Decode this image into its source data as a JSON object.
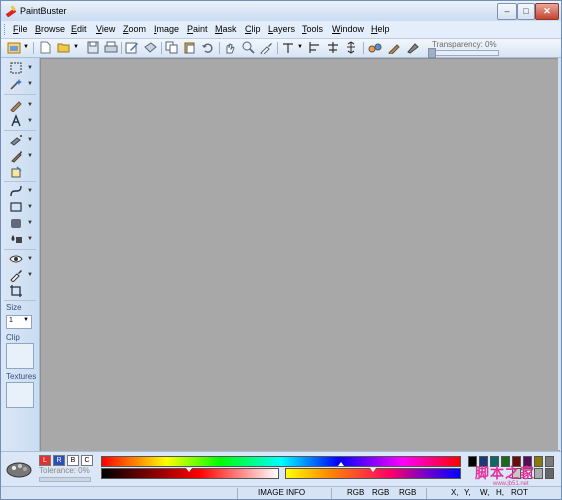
{
  "window": {
    "title": "PaintBuster",
    "controls": {
      "minimize": "–",
      "maximize": "□",
      "close": "✕"
    }
  },
  "menu": [
    {
      "label": "File",
      "key": "F",
      "rest": "ile"
    },
    {
      "label": "Browse",
      "key": "B",
      "rest": "rowse"
    },
    {
      "label": "Edit",
      "key": "E",
      "rest": "dit"
    },
    {
      "label": "View",
      "key": "V",
      "rest": "iew"
    },
    {
      "label": "Zoom",
      "key": "Z",
      "rest": "oom"
    },
    {
      "label": "Image",
      "key": "I",
      "rest": "mage"
    },
    {
      "label": "Paint",
      "key": "P",
      "rest": "aint"
    },
    {
      "label": "Mask",
      "key": "M",
      "rest": "ask"
    },
    {
      "label": "Clip",
      "key": "C",
      "rest": "lip"
    },
    {
      "label": "Layers",
      "key": "L",
      "rest": "ayers"
    },
    {
      "label": "Tools",
      "key": "T",
      "rest": "ools"
    },
    {
      "label": "Window",
      "key": "W",
      "rest": "indow"
    },
    {
      "label": "Help",
      "key": "H",
      "rest": "elp"
    }
  ],
  "toolbar": {
    "transparency_label": "Transparency: 0%",
    "transparency_value": 0
  },
  "left_panel": {
    "size_label": "Size",
    "size_value": "1",
    "clip_label": "Clip",
    "textures_label": "Textures"
  },
  "color_panel": {
    "channels": [
      "L",
      "R",
      "B",
      "C"
    ],
    "tolerance_label": "Tolerance: 0%",
    "swatch_colors": [
      "#000000",
      "#1a3a7a",
      "#0a6a6a",
      "#1a6a1a",
      "#6a0a0a",
      "#5a0a5a",
      "#8a7a0a",
      "#7a7a7a",
      "#c8c8c8",
      "#ffffff",
      "#aaaaaa",
      "#666666"
    ]
  },
  "status": {
    "image_info": "IMAGE INFO",
    "rgb1": "RGB",
    "rgb2": "RGB",
    "rgb3": "RGB",
    "x": "X,",
    "y": "Y,",
    "w": "W,",
    "h": "H,",
    "rot": "ROT"
  },
  "watermark": {
    "text": "脚本之家",
    "sub": "www.jb51.net"
  },
  "colors": {
    "workspace": "#a8a8a8",
    "chrome": "#cfe0f3",
    "accent": "#6f8fb8"
  }
}
